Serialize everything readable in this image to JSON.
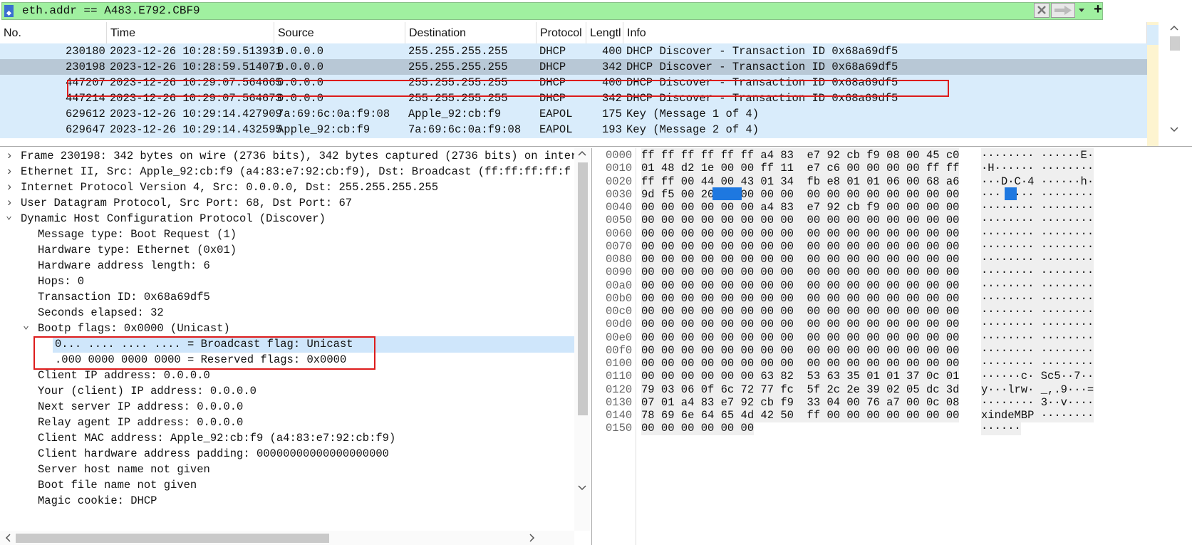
{
  "filter": {
    "text": "eth.addr == A483.E792.CBF9",
    "add_label": "+"
  },
  "packet_list": {
    "columns": [
      "No.",
      "Time",
      "Source",
      "Destination",
      "Protocol",
      "Lengtl",
      "Info"
    ],
    "rows": [
      {
        "no": "230180",
        "time": "2023-12-26 10:28:59.513931",
        "src": "0.0.0.0",
        "dst": "255.255.255.255",
        "proto": "DHCP",
        "len": "400",
        "info": "DHCP Discover - Transaction ID 0x68a69df5",
        "selected": false
      },
      {
        "no": "230198",
        "time": "2023-12-26 10:28:59.514071",
        "src": "0.0.0.0",
        "dst": "255.255.255.255",
        "proto": "DHCP",
        "len": "342",
        "info": "DHCP Discover - Transaction ID 0x68a69df5",
        "selected": true
      },
      {
        "no": "447207",
        "time": "2023-12-26 10:29:07.564665",
        "src": "0.0.0.0",
        "dst": "255.255.255.255",
        "proto": "DHCP",
        "len": "400",
        "info": "DHCP Discover - Transaction ID 0x68a69df5",
        "selected": false
      },
      {
        "no": "447214",
        "time": "2023-12-26 10:29:07.564673",
        "src": "0.0.0.0",
        "dst": "255.255.255.255",
        "proto": "DHCP",
        "len": "342",
        "info": "DHCP Discover - Transaction ID 0x68a69df5",
        "selected": false
      },
      {
        "no": "629612",
        "time": "2023-12-26 10:29:14.427909",
        "src": "7a:69:6c:0a:f9:08",
        "dst": "Apple_92:cb:f9",
        "proto": "EAPOL",
        "len": "175",
        "info": "Key (Message 1 of 4)",
        "selected": false
      },
      {
        "no": "629647",
        "time": "2023-12-26 10:29:14.432595",
        "src": "Apple_92:cb:f9",
        "dst": "7a:69:6c:0a:f9:08",
        "proto": "EAPOL",
        "len": "193",
        "info": "Key (Message 2 of 4)",
        "selected": false
      }
    ]
  },
  "detail_tree": [
    {
      "text": "Frame 230198: 342 bytes on wire (2736 bits), 342 bytes captured (2736 bits) on inter",
      "arrow": "›",
      "indent": 0
    },
    {
      "text": "Ethernet II, Src: Apple_92:cb:f9 (a4:83:e7:92:cb:f9), Dst: Broadcast (ff:ff:ff:ff:f",
      "arrow": "›",
      "indent": 0
    },
    {
      "text": "Internet Protocol Version 4, Src: 0.0.0.0, Dst: 255.255.255.255",
      "arrow": "›",
      "indent": 0
    },
    {
      "text": "User Datagram Protocol, Src Port: 68, Dst Port: 67",
      "arrow": "›",
      "indent": 0
    },
    {
      "text": "Dynamic Host Configuration Protocol (Discover)",
      "arrow": "⌄",
      "indent": 0
    },
    {
      "text": "Message type: Boot Request (1)",
      "arrow": "",
      "indent": 1
    },
    {
      "text": "Hardware type: Ethernet (0x01)",
      "arrow": "",
      "indent": 1
    },
    {
      "text": "Hardware address length: 6",
      "arrow": "",
      "indent": 1
    },
    {
      "text": "Hops: 0",
      "arrow": "",
      "indent": 1
    },
    {
      "text": "Transaction ID: 0x68a69df5",
      "arrow": "",
      "indent": 1
    },
    {
      "text": "Seconds elapsed: 32",
      "arrow": "",
      "indent": 1
    },
    {
      "text": "Bootp flags: 0x0000 (Unicast)",
      "arrow": "⌄",
      "indent": 1
    },
    {
      "text": "0... .... .... .... = Broadcast flag: Unicast",
      "arrow": "",
      "indent": 2,
      "selected": true
    },
    {
      "text": ".000 0000 0000 0000 = Reserved flags: 0x0000",
      "arrow": "",
      "indent": 2
    },
    {
      "text": "Client IP address: 0.0.0.0",
      "arrow": "",
      "indent": 1
    },
    {
      "text": "Your (client) IP address: 0.0.0.0",
      "arrow": "",
      "indent": 1
    },
    {
      "text": "Next server IP address: 0.0.0.0",
      "arrow": "",
      "indent": 1
    },
    {
      "text": "Relay agent IP address: 0.0.0.0",
      "arrow": "",
      "indent": 1
    },
    {
      "text": "Client MAC address: Apple_92:cb:f9 (a4:83:e7:92:cb:f9)",
      "arrow": "",
      "indent": 1
    },
    {
      "text": "Client hardware address padding: 00000000000000000000",
      "arrow": "",
      "indent": 1
    },
    {
      "text": "Server host name not given",
      "arrow": "",
      "indent": 1
    },
    {
      "text": "Boot file name not given",
      "arrow": "",
      "indent": 1
    },
    {
      "text": "Magic cookie: DHCP",
      "arrow": "",
      "indent": 1
    }
  ],
  "hex_dump": [
    {
      "off": "0000",
      "bytes": "ff ff ff ff ff ff a4 83  e7 92 cb f9 08 00 45 c0",
      "ascii": "········ ······E·"
    },
    {
      "off": "0010",
      "bytes": "01 48 d2 1e 00 00 ff 11  e7 c6 00 00 00 00 ff ff",
      "ascii": "·H······ ········"
    },
    {
      "off": "0020",
      "bytes": "ff ff 00 44 00 43 01 34  fb e8 01 01 06 00 68 a6",
      "ascii": "···D·C·4 ······h·"
    },
    {
      "off": "0030",
      "bytes": "9d f5 00 20 00 00 00 00  00 00 00 00 00 00 00 00",
      "ascii": "··· ···· ········",
      "hl": true
    },
    {
      "off": "0040",
      "bytes": "00 00 00 00 00 00 a4 83  e7 92 cb f9 00 00 00 00",
      "ascii": "········ ········"
    },
    {
      "off": "0050",
      "bytes": "00 00 00 00 00 00 00 00  00 00 00 00 00 00 00 00",
      "ascii": "········ ········"
    },
    {
      "off": "0060",
      "bytes": "00 00 00 00 00 00 00 00  00 00 00 00 00 00 00 00",
      "ascii": "········ ········"
    },
    {
      "off": "0070",
      "bytes": "00 00 00 00 00 00 00 00  00 00 00 00 00 00 00 00",
      "ascii": "········ ········"
    },
    {
      "off": "0080",
      "bytes": "00 00 00 00 00 00 00 00  00 00 00 00 00 00 00 00",
      "ascii": "········ ········"
    },
    {
      "off": "0090",
      "bytes": "00 00 00 00 00 00 00 00  00 00 00 00 00 00 00 00",
      "ascii": "········ ········"
    },
    {
      "off": "00a0",
      "bytes": "00 00 00 00 00 00 00 00  00 00 00 00 00 00 00 00",
      "ascii": "········ ········"
    },
    {
      "off": "00b0",
      "bytes": "00 00 00 00 00 00 00 00  00 00 00 00 00 00 00 00",
      "ascii": "········ ········"
    },
    {
      "off": "00c0",
      "bytes": "00 00 00 00 00 00 00 00  00 00 00 00 00 00 00 00",
      "ascii": "········ ········"
    },
    {
      "off": "00d0",
      "bytes": "00 00 00 00 00 00 00 00  00 00 00 00 00 00 00 00",
      "ascii": "········ ········"
    },
    {
      "off": "00e0",
      "bytes": "00 00 00 00 00 00 00 00  00 00 00 00 00 00 00 00",
      "ascii": "········ ········"
    },
    {
      "off": "00f0",
      "bytes": "00 00 00 00 00 00 00 00  00 00 00 00 00 00 00 00",
      "ascii": "········ ········"
    },
    {
      "off": "0100",
      "bytes": "00 00 00 00 00 00 00 00  00 00 00 00 00 00 00 00",
      "ascii": "········ ········"
    },
    {
      "off": "0110",
      "bytes": "00 00 00 00 00 00 63 82  53 63 35 01 01 37 0c 01",
      "ascii": "······c· Sc5··7··"
    },
    {
      "off": "0120",
      "bytes": "79 03 06 0f 6c 72 77 fc  5f 2c 2e 39 02 05 dc 3d",
      "ascii": "y···lrw· _,.9···="
    },
    {
      "off": "0130",
      "bytes": "07 01 a4 83 e7 92 cb f9  33 04 00 76 a7 00 0c 08",
      "ascii": "········ 3··v····"
    },
    {
      "off": "0140",
      "bytes": "78 69 6e 64 65 4d 42 50  ff 00 00 00 00 00 00 00",
      "ascii": "xindeMBP ········"
    },
    {
      "off": "0150",
      "bytes": "00 00 00 00 00 00",
      "ascii": "······"
    }
  ],
  "colors": {
    "filter_valid": "#a0f0a0",
    "row_bg": "#d9ecfb",
    "row_selected": "#b8c8d6",
    "annotation": "#dd1c1c",
    "byte_highlight": "#1e78e0"
  }
}
